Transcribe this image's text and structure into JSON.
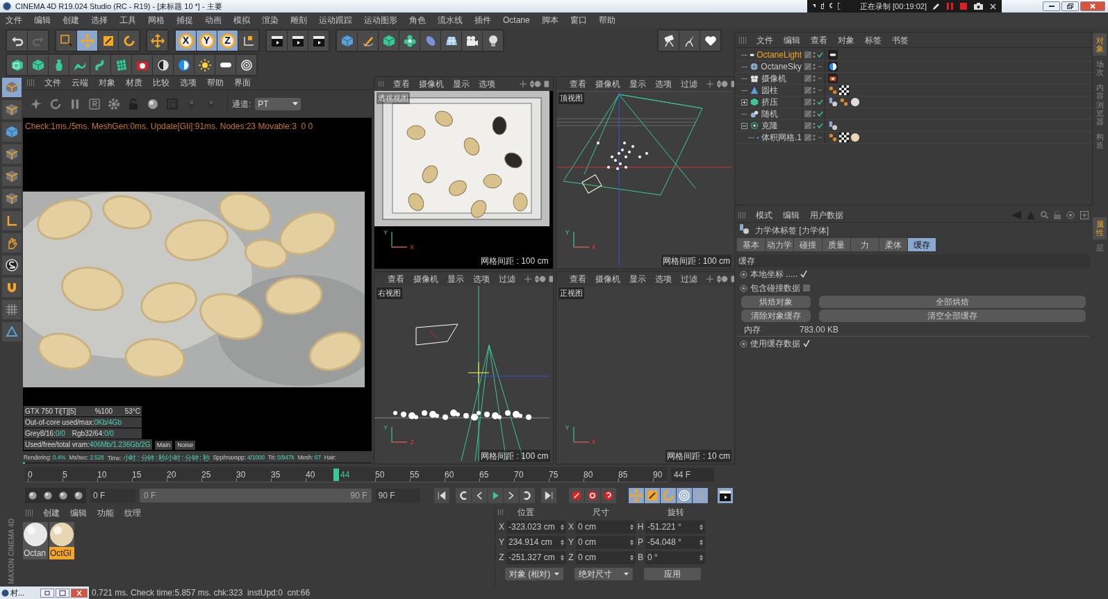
{
  "title_bar": {
    "title": "CINEMA 4D R19.024 Studio (RC - R19) - [未标题 10 *] - 主要"
  },
  "recorder": {
    "status": "正在录制 [00:19:02]"
  },
  "menu": [
    "文件",
    "编辑",
    "创建",
    "选择",
    "工具",
    "网格",
    "捕捉",
    "动画",
    "模拟",
    "渲染",
    "雕刻",
    "运动跟踪",
    "运动图形",
    "角色",
    "流水线",
    "插件",
    "Octane",
    "脚本",
    "窗口",
    "帮助"
  ],
  "axis_buttons": [
    {
      "label": "X",
      "on": true
    },
    {
      "label": "Y",
      "on": true
    },
    {
      "label": "Z",
      "on": true
    }
  ],
  "octane_viewer": {
    "menu": [
      "文件",
      "云端",
      "对象",
      "材质",
      "比较",
      "选项",
      "帮助",
      "界面"
    ],
    "channel_label": "通道:",
    "channel": "PT",
    "log": "Check:1ms./5ms. MeshGen:0ms. Update[GIi]:91ms. Nodes:23 Movable:3  0 0",
    "gpu": [
      "GTX 750 Ti[T][5]",
      "%100",
      "53°C"
    ],
    "stats": [
      [
        {
          "label": "Out-of-core used/max:",
          "value": "0Kb/4Gb"
        }
      ],
      [
        {
          "label": "Grey8/16:",
          "value": "0/0"
        },
        {
          "label": "Rgb32/64:",
          "value": "0/0"
        }
      ],
      [
        {
          "label": "Used/free/total vram:",
          "value": "406Mb/1.236Gb/2G"
        }
      ]
    ],
    "buttons": [
      "Main",
      "Noise"
    ],
    "status": [
      {
        "label": "Rendering:",
        "value": "0.4%"
      },
      {
        "label": "Ms/sec:",
        "value": "2.528"
      },
      {
        "label": "Time:",
        "value": "小时 : 分钟 : 秒/小时 : 分钟 : 秒"
      },
      {
        "label": "Spp/maxspp:",
        "value": "4/1000"
      },
      {
        "label": "Tri:",
        "value": "0/947k"
      },
      {
        "label": "Mesh:",
        "value": "67"
      },
      {
        "label": "Hair:"
      }
    ],
    "progress": {
      "level": 0.004
    }
  },
  "viewports": [
    {
      "kind": "render",
      "menu": [
        "查看",
        "摄像机",
        "显示",
        "选项"
      ],
      "name": "透视视图",
      "grid": "网格间距 : 100 cm",
      "axes": [
        "Y",
        "X"
      ]
    },
    {
      "kind": "top",
      "menu": [
        "查看",
        "摄像机",
        "显示",
        "选项",
        "过滤"
      ],
      "name": "顶视图",
      "grid": "网格间距 : 100 cm",
      "axes": [
        "Y",
        "X"
      ]
    },
    {
      "kind": "right",
      "menu": [
        "查看",
        "摄像机",
        "显示",
        "选项",
        "过滤"
      ],
      "name": "右视图",
      "grid": "网格间距 : 100 cm",
      "axes": [
        "Y",
        "Z"
      ]
    },
    {
      "kind": "front",
      "menu": [
        "查看",
        "摄像机",
        "显示",
        "选项",
        "过滤"
      ],
      "name": "正视图",
      "grid": "网格间距 : 10 cm",
      "axes": [
        "Y",
        "X"
      ]
    }
  ],
  "objects": {
    "menu": [
      "文件",
      "编辑",
      "查看",
      "对象",
      "标签",
      "书签"
    ],
    "items": [
      {
        "name": "OctaneLight",
        "kind": "light",
        "selected": true,
        "enabled": true,
        "tags": [
          {
            "kind": "lighttag"
          }
        ]
      },
      {
        "name": "OctaneSky",
        "kind": "sky",
        "selected": false,
        "enabled": false,
        "tags": [
          {
            "kind": "skytag"
          }
        ]
      },
      {
        "name": "摄像机",
        "kind": "camera",
        "selected": false,
        "enabled": false,
        "tags": [
          {
            "kind": "cameratag"
          }
        ]
      },
      {
        "name": "圆柱",
        "kind": "mesh",
        "selected": false,
        "enabled": false,
        "tags": [
          {
            "kind": "dots"
          },
          {
            "kind": "checker"
          }
        ]
      },
      {
        "name": "挤压",
        "kind": "extrude",
        "selected": false,
        "enabled": true,
        "expanded": false,
        "tags": [
          {
            "kind": "dynamics"
          },
          {
            "kind": "dots"
          },
          {
            "kind": "sphere"
          }
        ]
      },
      {
        "name": "随机",
        "kind": "effector",
        "selected": false,
        "enabled": true
      },
      {
        "name": "克隆",
        "kind": "cloner",
        "selected": false,
        "enabled": true,
        "expanded": true,
        "tags": [
          {
            "kind": "dynamics"
          }
        ],
        "children": [
          {
            "name": "体积网格.1",
            "kind": "mesh",
            "selected": false,
            "enabled": false,
            "tags": [
              {
                "kind": "dots"
              },
              {
                "kind": "checker"
              },
              {
                "kind": "beige"
              }
            ]
          }
        ]
      }
    ]
  },
  "attributes": {
    "menu": [
      "模式",
      "编辑",
      "用户数据"
    ],
    "header": "力学体标签 [力学体]",
    "tabs": [
      {
        "label": "基本",
        "selected": false
      },
      {
        "label": "动力学",
        "selected": false
      },
      {
        "label": "碰撞",
        "selected": false
      },
      {
        "label": "质量",
        "selected": false
      },
      {
        "label": "力",
        "selected": false
      },
      {
        "label": "柔体",
        "selected": false
      },
      {
        "label": "缓存",
        "selected": true
      }
    ],
    "section": "缓存",
    "options": [
      {
        "label": "本地坐标",
        "dots": ".....",
        "checked": true
      },
      {
        "label": "包含碰撞数据",
        "checked": false
      }
    ],
    "buttons": [
      [
        "烘焙对象",
        "全部烘焙"
      ],
      [
        "清除对象缓存",
        "清空全部缓存"
      ]
    ],
    "memory": {
      "label": "内存",
      "value": "783.00 KB"
    },
    "options2": [
      {
        "label": "使用缓存数据",
        "checked": true
      }
    ]
  },
  "side_tabs_top": [
    {
      "label": "对象",
      "selected": true
    },
    {
      "label": "场次",
      "selected": false
    },
    {
      "label": "内容浏览器",
      "selected": false
    },
    {
      "label": "构造",
      "selected": false
    }
  ],
  "side_tabs_bottom": [
    {
      "label": "属性",
      "selected": true
    },
    {
      "label": "层",
      "selected": false
    }
  ],
  "timeline": {
    "ticks": [
      "0",
      "5",
      "10",
      "15",
      "20",
      "25",
      "30",
      "35",
      "40",
      "50",
      "55",
      "60",
      "65",
      "70",
      "75",
      "80",
      "85",
      "90"
    ],
    "current": "44",
    "level": 0.489,
    "frame": "44 F"
  },
  "playback": {
    "start": "0 F",
    "range_start": "0 F",
    "range_end": "90 F",
    "level": 1,
    "end": "90 F"
  },
  "materials": {
    "menu": [
      "创建",
      "编辑",
      "功能",
      "纹理"
    ],
    "items": [
      {
        "name": "Octan",
        "selected": false,
        "kind": "white"
      },
      {
        "name": "OctGl",
        "selected": true,
        "kind": "beige"
      }
    ]
  },
  "coordinates": {
    "headers": [
      "位置",
      "尺寸",
      "旋转"
    ],
    "rows": [
      [
        {
          "axis": "X",
          "value": "-323.023 cm"
        },
        {
          "axis": "X",
          "value": "0 cm"
        },
        {
          "axis": "H",
          "value": "-51.221 °"
        }
      ],
      [
        {
          "axis": "Y",
          "value": "234.914 cm"
        },
        {
          "axis": "Y",
          "value": "0 cm"
        },
        {
          "axis": "P",
          "value": "-54.048 °"
        }
      ],
      [
        {
          "axis": "Z",
          "value": "-251.327 cm"
        },
        {
          "axis": "Z",
          "value": "0 cm"
        },
        {
          "axis": "B",
          "value": "0 °"
        }
      ]
    ],
    "mode": "对象 (相对)",
    "size_mode": "绝对尺寸",
    "apply": "应用"
  },
  "brand": "MAXON CINEMA 4D",
  "taskbar": {
    "label": "村..."
  },
  "status_bar": "0.721 ms. Check time:5.857 ms. chk:323  instUpd:0  cnt:66"
}
